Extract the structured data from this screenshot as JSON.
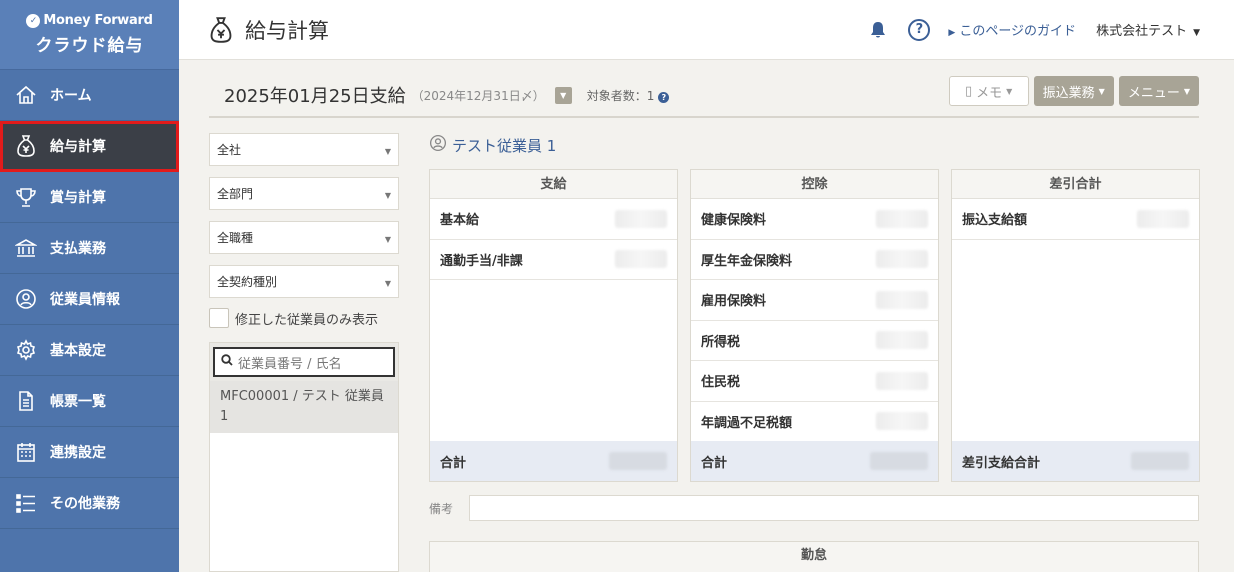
{
  "brand": {
    "company": "Money Forward",
    "product": "クラウド給与"
  },
  "sidebar": {
    "items": [
      {
        "label": "ホーム",
        "icon": "home-icon"
      },
      {
        "label": "給与計算",
        "icon": "money-bag-icon",
        "active": true
      },
      {
        "label": "賞与計算",
        "icon": "trophy-icon"
      },
      {
        "label": "支払業務",
        "icon": "bank-icon"
      },
      {
        "label": "従業員情報",
        "icon": "person-icon"
      },
      {
        "label": "基本設定",
        "icon": "gear-icon"
      },
      {
        "label": "帳票一覧",
        "icon": "document-icon"
      },
      {
        "label": "連携設定",
        "icon": "calendar-icon"
      },
      {
        "label": "その他業務",
        "icon": "list-icon"
      }
    ]
  },
  "header": {
    "title": "給与計算",
    "guide_label": "このページのガイド",
    "company_label": "株式会社テスト",
    "help_label": "?"
  },
  "subheader": {
    "pay_date": "2025年01月25日支給",
    "cutoff": "（2024年12月31日〆）",
    "target_count": "対象者数：1",
    "memo_label": "メモ",
    "transfer_label": "振込業務",
    "menu_label": "メニュー"
  },
  "filters": {
    "company": "全社",
    "department": "全部門",
    "job_type": "全職種",
    "contract_type": "全契約種別",
    "modified_only_label": "修正した従業員のみ表示",
    "search_placeholder": "従業員番号 / 氏名",
    "employees": [
      "MFC00001 / テスト 従業員 1"
    ]
  },
  "employee": {
    "name": "テスト従業員 1"
  },
  "payment": {
    "header": "支給",
    "rows": [
      "基本給",
      "通勤手当/非課"
    ],
    "total_label": "合計"
  },
  "deduction": {
    "header": "控除",
    "rows": [
      "健康保険料",
      "厚生年金保険料",
      "雇用保険料",
      "所得税",
      "住民税",
      "年調過不足税額"
    ],
    "total_label": "合計"
  },
  "net": {
    "header": "差引合計",
    "rows": [
      "振込支給額"
    ],
    "total_label": "差引支給合計"
  },
  "remarks_label": "備考",
  "attendance_header": "勤怠",
  "colors": {
    "sidebar": "#4e74ab",
    "active": "#3b3f47",
    "highlight": "#e21b1b",
    "accent": "#3b5f96",
    "button": "#a8a496"
  }
}
